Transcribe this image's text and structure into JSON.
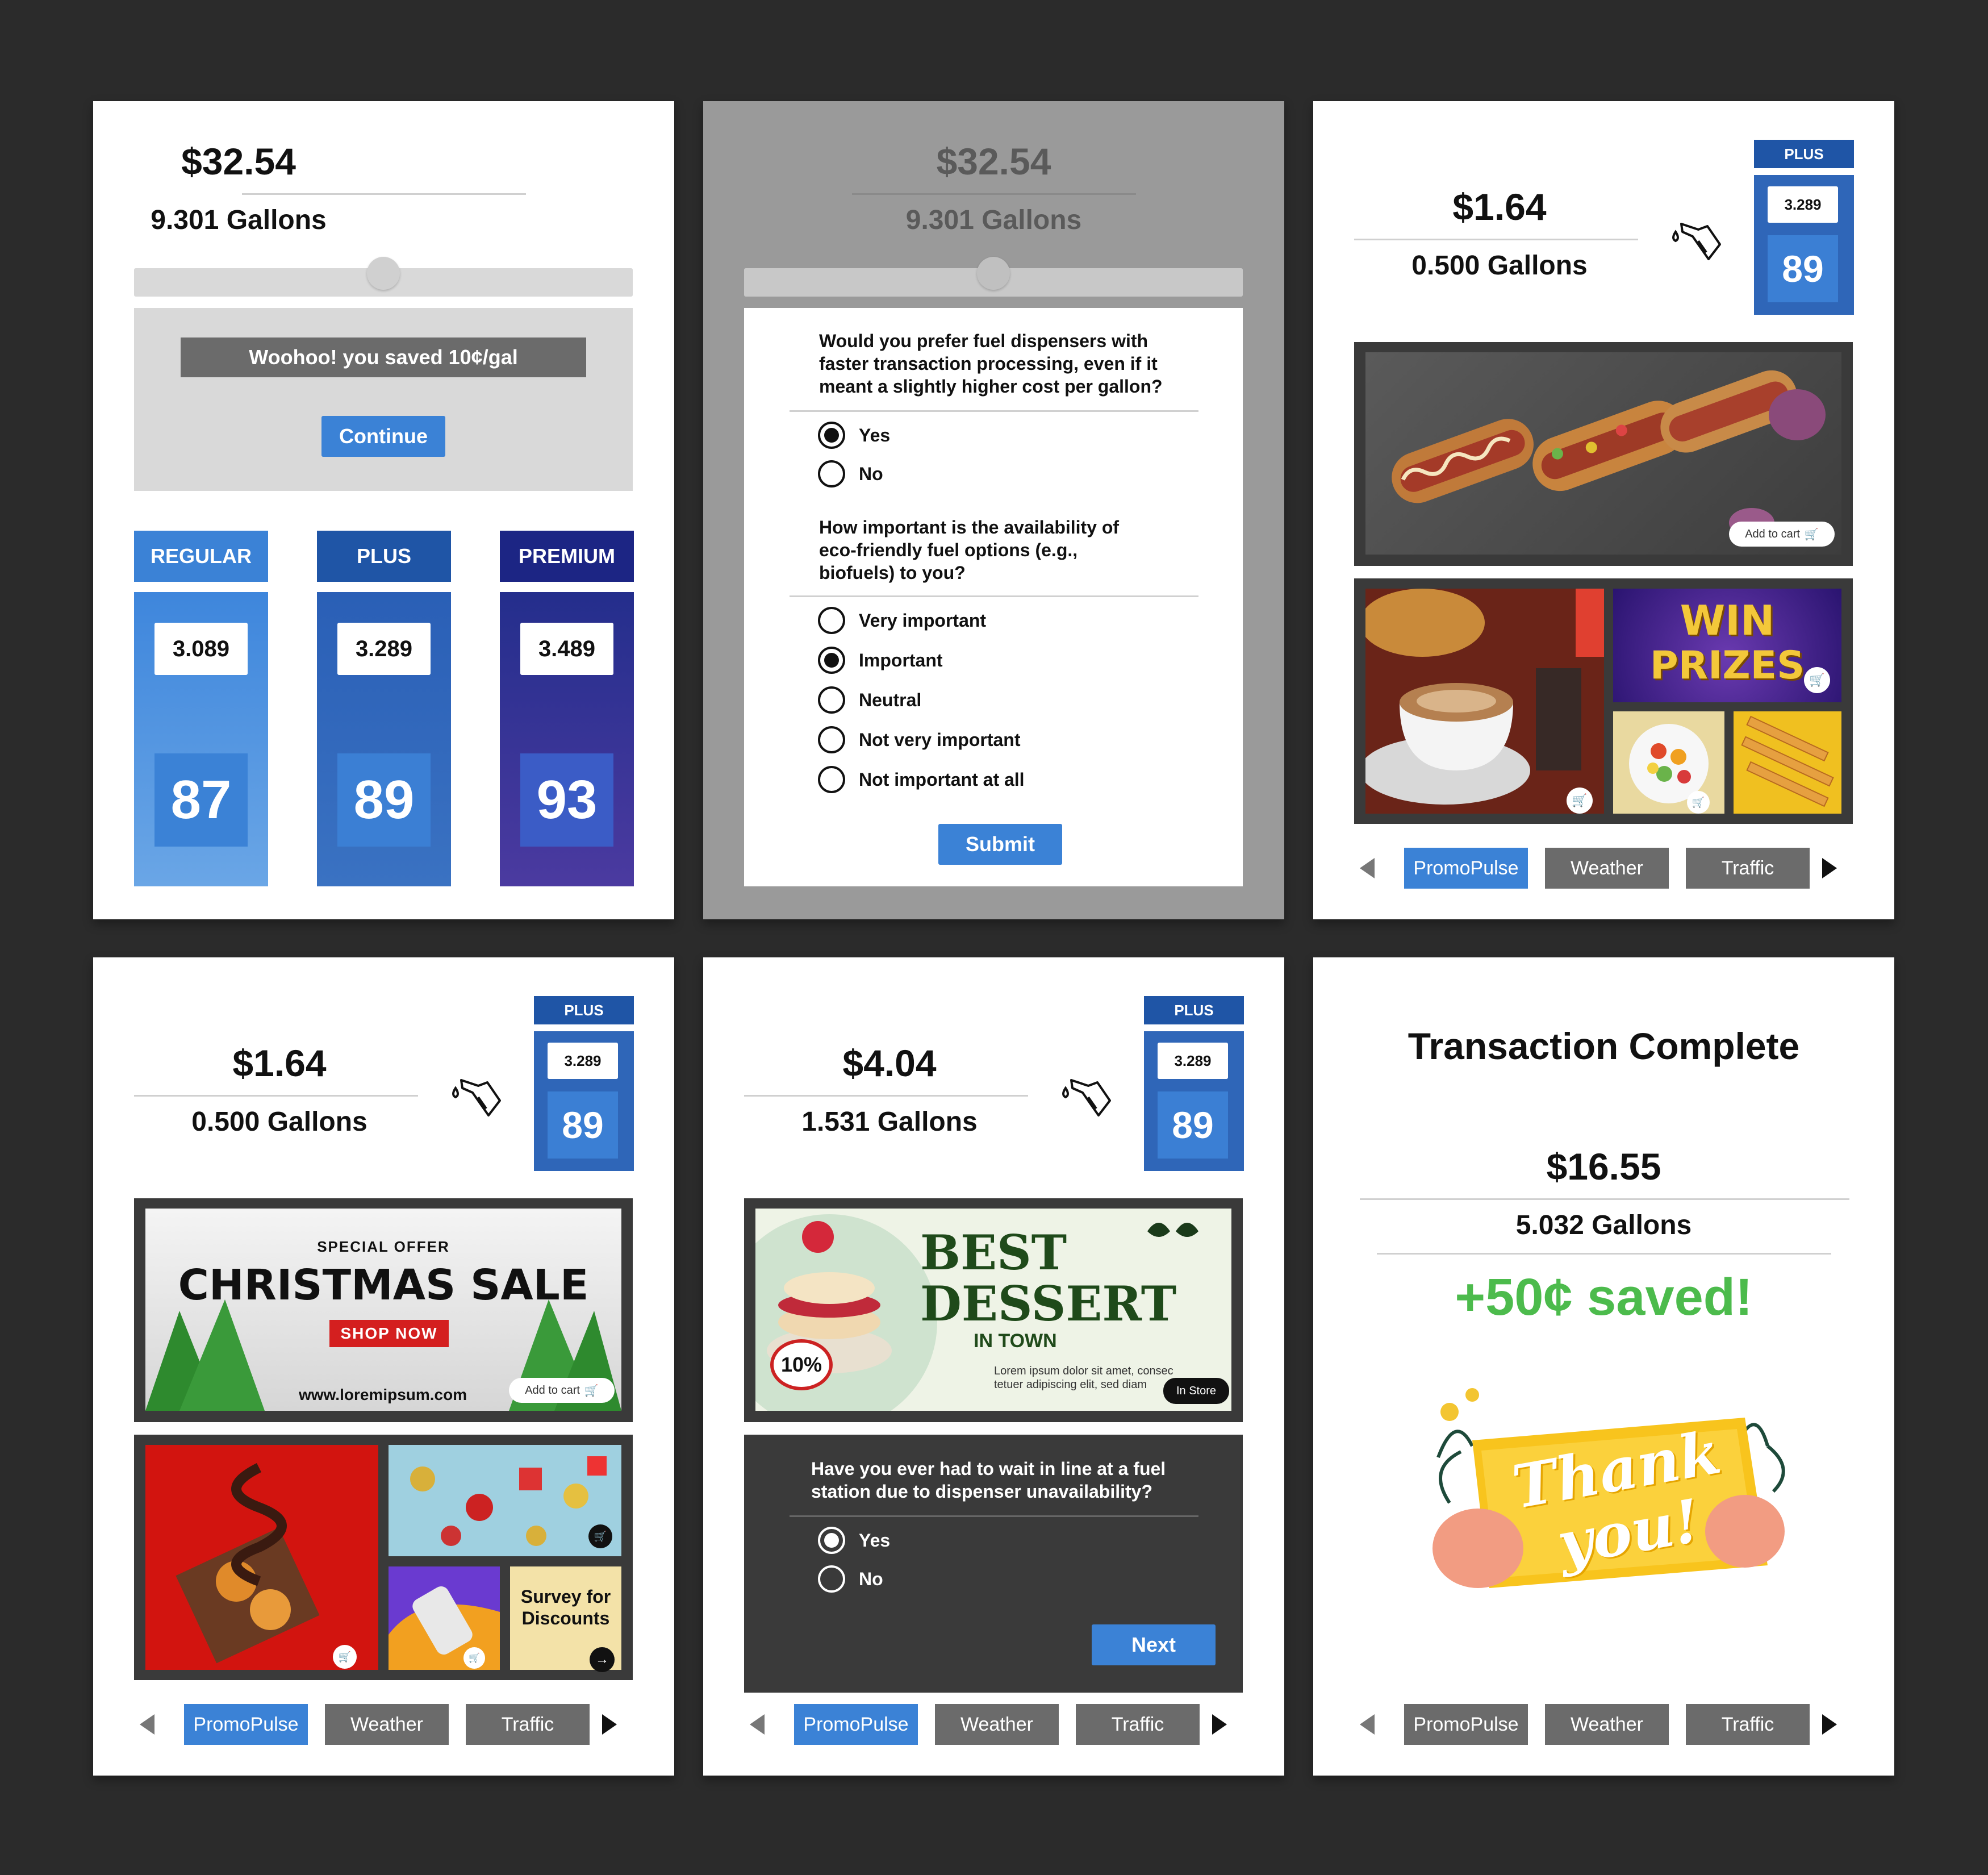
{
  "screen1": {
    "price": "$32.54",
    "gallons": "9.301 Gallons",
    "banner": "Woohoo! you saved 10¢/gal",
    "continue": "Continue",
    "grades": [
      {
        "name": "REGULAR",
        "price": "3.089",
        "octane": "87"
      },
      {
        "name": "PLUS",
        "price": "3.289",
        "octane": "89"
      },
      {
        "name": "PREMIUM",
        "price": "3.489",
        "octane": "93"
      }
    ]
  },
  "screen2": {
    "price": "$32.54",
    "gallons": "9.301 Gallons",
    "q1": "Would you prefer fuel dispensers with faster transaction processing, even if it meant a slightly higher cost per gallon?",
    "q1_options": [
      "Yes",
      "No"
    ],
    "q2": "How important is the availability of eco-friendly fuel options (e.g., biofuels) to you?",
    "q2_options": [
      "Very important",
      "Important",
      "Neutral",
      "Not very important",
      "Not important at all"
    ],
    "submit": "Submit"
  },
  "screen3": {
    "price": "$1.64",
    "gallons": "0.500 Gallons",
    "grade": "PLUS",
    "grade_price": "3.289",
    "octane": "89",
    "add_to_cart": "Add to cart",
    "win": "WIN",
    "prizes": "PRIZES"
  },
  "screen4": {
    "price": "$1.64",
    "gallons": "0.500 Gallons",
    "grade": "PLUS",
    "grade_price": "3.289",
    "octane": "89",
    "special": "SPECIAL OFFER",
    "christmas": "CHRISTMAS SALE",
    "shop": "SHOP NOW",
    "url": "www.loremipsum.com",
    "add_to_cart": "Add to cart",
    "survey": "Survey for Discounts"
  },
  "screen5": {
    "price": "$4.04",
    "gallons": "1.531 Gallons",
    "grade": "PLUS",
    "grade_price": "3.289",
    "octane": "89",
    "best": "BEST",
    "dessert": "DESSERT",
    "in_town": "IN TOWN",
    "discount": "10%",
    "lorem": "Lorem ipsum dolor sit amet, consec tetuer adipiscing elit, sed diam",
    "in_store": "In Store",
    "question": "Have you ever had to wait in line at a fuel station due to dispenser unavailability?",
    "options": [
      "Yes",
      "No"
    ],
    "next": "Next"
  },
  "screen6": {
    "title": "Transaction Complete",
    "price": "$16.55",
    "gallons": "5.032 Gallons",
    "saved": "+50¢ saved!",
    "thank1": "Thank",
    "thank2": "you!"
  },
  "tabs": [
    "PromoPulse",
    "Weather",
    "Traffic"
  ],
  "colors": {
    "accent": "#3b82d6",
    "regular": "#4a8fd8",
    "plus": "#2f66b8",
    "premium": "#2e2f8f",
    "saved_green": "#4cbb4c",
    "ad_frame": "#3a3a3a"
  }
}
